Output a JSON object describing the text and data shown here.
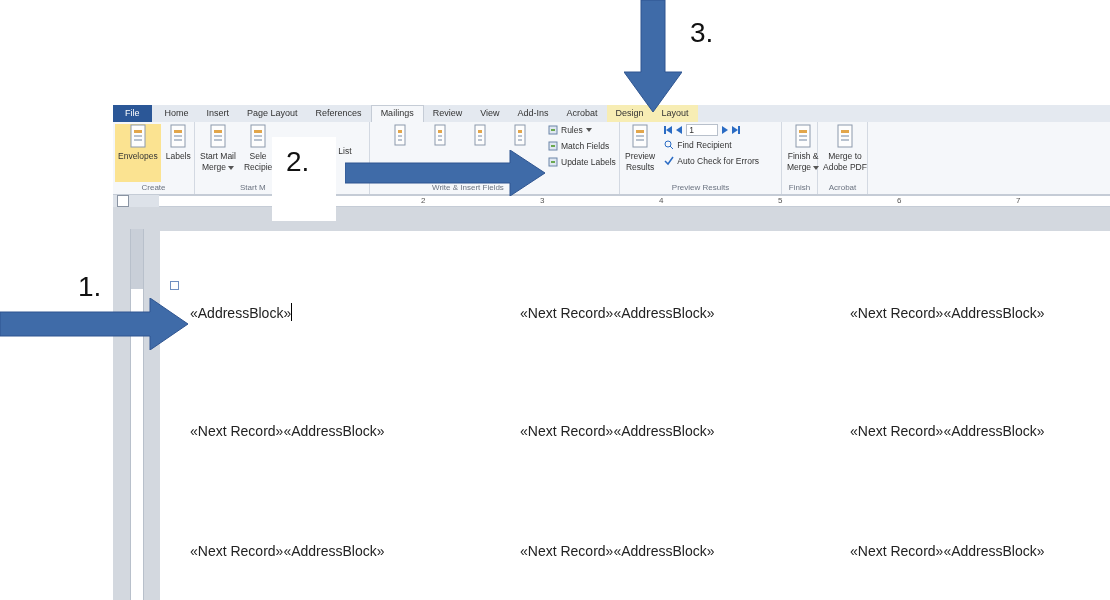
{
  "annotations": [
    {
      "number": "3."
    },
    {
      "number": "2."
    },
    {
      "number": "1."
    }
  ],
  "ribbon": {
    "tabs": [
      {
        "label": "File",
        "kind": "file",
        "selected": false
      },
      {
        "label": "Home",
        "kind": "normal",
        "selected": false
      },
      {
        "label": "Insert",
        "kind": "normal",
        "selected": false
      },
      {
        "label": "Page Layout",
        "kind": "normal",
        "selected": false
      },
      {
        "label": "References",
        "kind": "normal",
        "selected": false
      },
      {
        "label": "Mailings",
        "kind": "normal",
        "selected": true
      },
      {
        "label": "Review",
        "kind": "normal",
        "selected": false
      },
      {
        "label": "View",
        "kind": "normal",
        "selected": false
      },
      {
        "label": "Add-Ins",
        "kind": "normal",
        "selected": false
      },
      {
        "label": "Acrobat",
        "kind": "normal",
        "selected": false
      },
      {
        "label": "Design",
        "kind": "contextual",
        "selected": false
      },
      {
        "label": "Layout",
        "kind": "contextual",
        "selected": false
      }
    ],
    "groups": [
      {
        "label": "Create",
        "items": [
          {
            "kind": "large",
            "lines": [
              "Envelopes"
            ],
            "highlighted": true
          },
          {
            "kind": "large",
            "lines": [
              "Labels"
            ],
            "highlighted": false
          }
        ]
      },
      {
        "label": "Start M",
        "items": [
          {
            "kind": "large",
            "lines": [
              "Start Mail",
              "Merge"
            ],
            "dropdown": true
          },
          {
            "kind": "large",
            "lines": [
              "Sele",
              "Recipie"
            ]
          },
          {
            "kind": "text",
            "lines": [
              "List"
            ]
          }
        ]
      },
      {
        "label": "Write & Insert Fields",
        "items": [
          {
            "kind": "icon"
          },
          {
            "kind": "icon"
          },
          {
            "kind": "icon"
          },
          {
            "kind": "icon"
          },
          {
            "kind": "small",
            "lines": [
              "Rules",
              "Match Fields",
              "Update Labels"
            ],
            "dropdown": true
          }
        ]
      },
      {
        "label": "Preview Results",
        "items": [
          {
            "kind": "large",
            "lines": [
              "Preview",
              "Results"
            ]
          },
          {
            "kind": "nav",
            "lines": [
              "1",
              "Find Recipient",
              "Auto Check for Errors"
            ]
          }
        ]
      },
      {
        "label": "Finish",
        "items": [
          {
            "kind": "large",
            "lines": [
              "Finish &",
              "Merge"
            ],
            "dropdown": true
          }
        ]
      },
      {
        "label": "Acrobat",
        "items": [
          {
            "kind": "large",
            "lines": [
              "Merge to",
              "Adobe PDF"
            ]
          }
        ]
      }
    ]
  },
  "ruler": {
    "numbers": [
      "2",
      "3",
      "4",
      "5",
      "6",
      "7"
    ]
  },
  "labels": [
    {
      "text": "«AddressBlock»",
      "cursor": true
    },
    {
      "text": "«Next Record»«AddressBlock»",
      "cursor": false
    },
    {
      "text": "«Next Record»«AddressBlock»",
      "cursor": false
    },
    {
      "text": "«Next Record»«AddressBlock»",
      "cursor": false
    },
    {
      "text": "«Next Record»«AddressBlock»",
      "cursor": false
    },
    {
      "text": "«Next Record»«AddressBlock»",
      "cursor": false
    },
    {
      "text": "«Next Record»«AddressBlock»",
      "cursor": false
    },
    {
      "text": "«Next Record»«AddressBlock»",
      "cursor": false
    },
    {
      "text": "«Next Record»«AddressBlock»",
      "cursor": false
    }
  ]
}
